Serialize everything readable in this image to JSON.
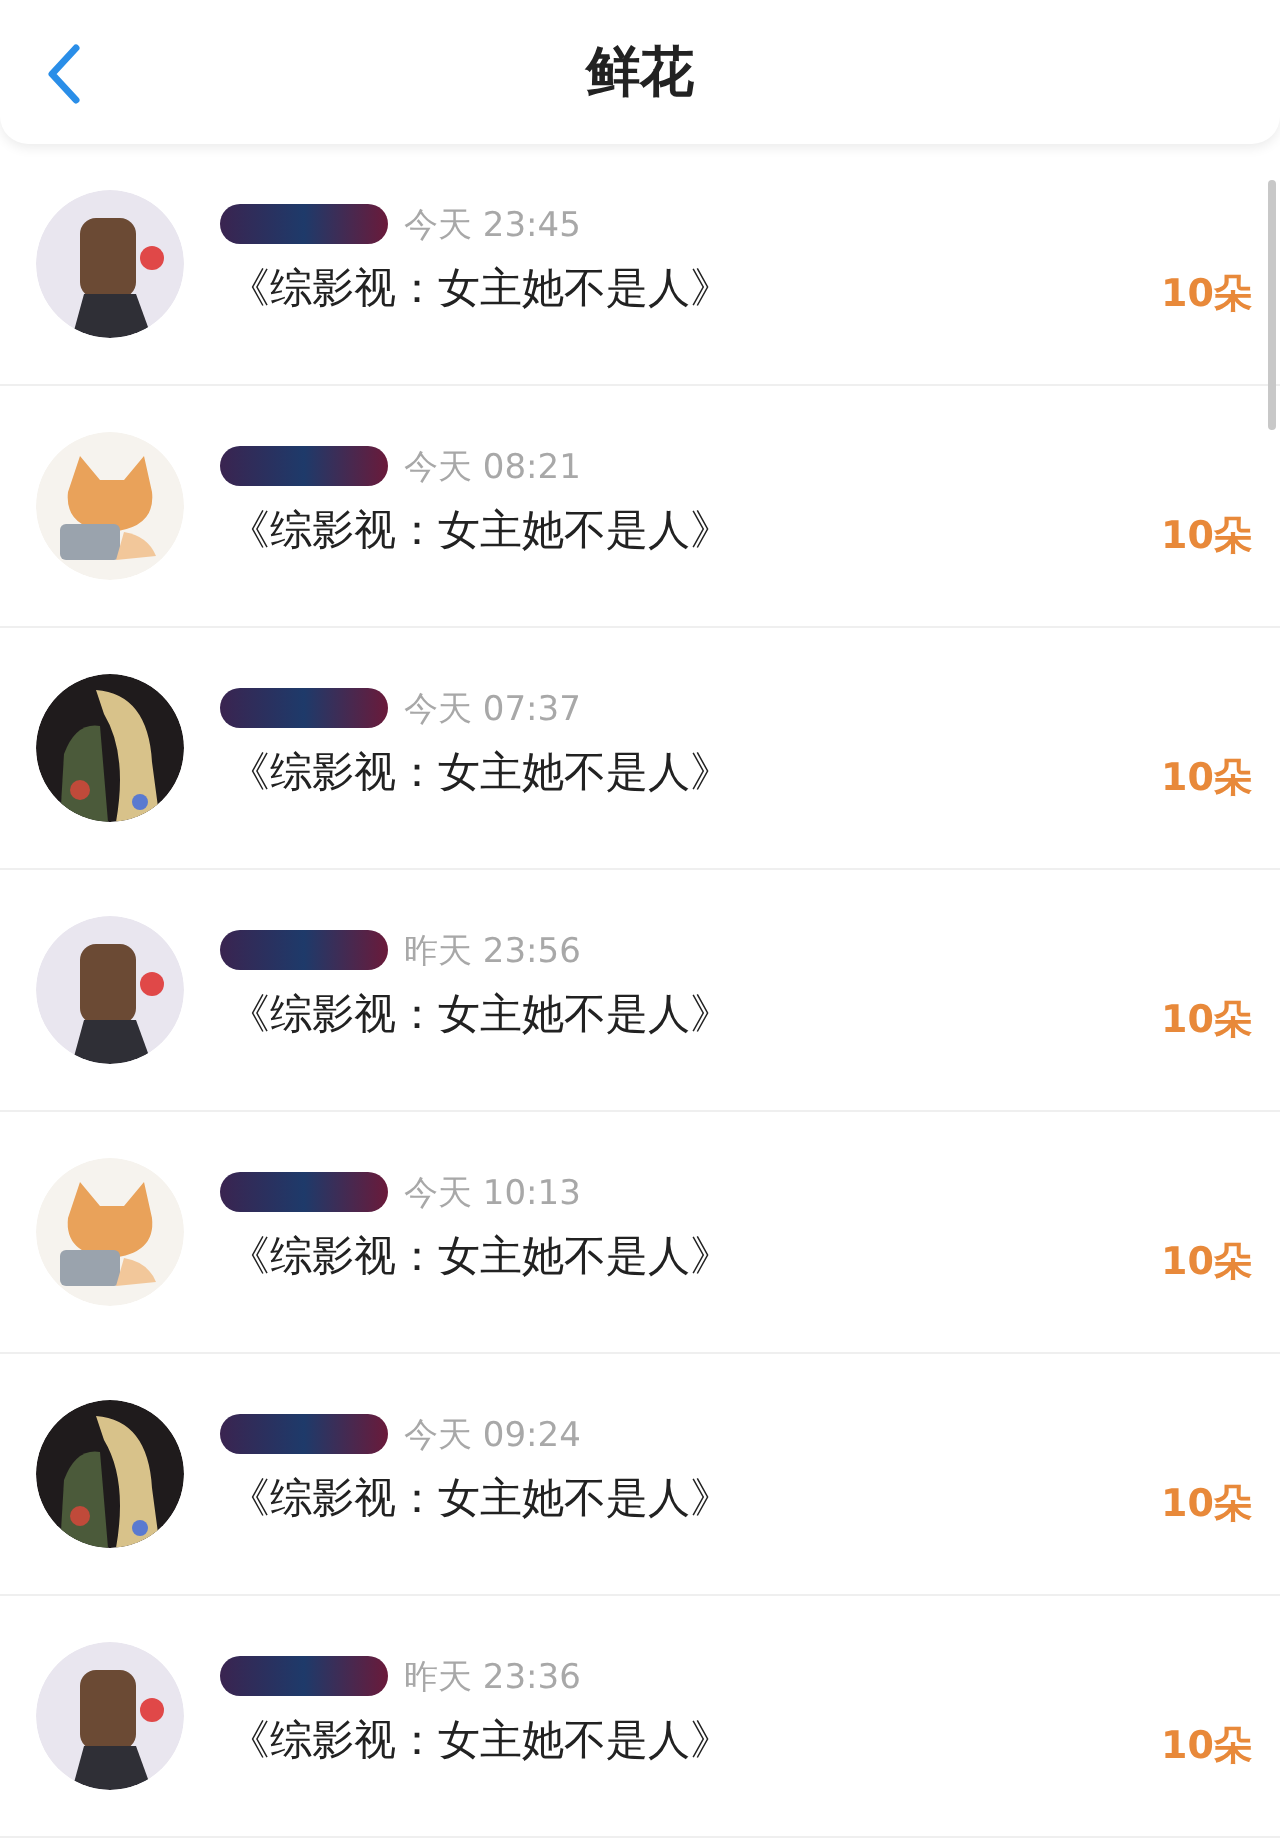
{
  "header": {
    "title": "鲜花"
  },
  "gifts": [
    {
      "kind": "figure",
      "time": "今天 23:45",
      "book": "《综影视：女主她不是人》",
      "count": "10朵"
    },
    {
      "kind": "cat",
      "time": "今天 08:21",
      "book": "《综影视：女主她不是人》",
      "count": "10朵"
    },
    {
      "kind": "portrait",
      "time": "今天 07:37",
      "book": "《综影视：女主她不是人》",
      "count": "10朵"
    },
    {
      "kind": "figure",
      "time": "昨天 23:56",
      "book": "《综影视：女主她不是人》",
      "count": "10朵"
    },
    {
      "kind": "cat",
      "time": "今天 10:13",
      "book": "《综影视：女主她不是人》",
      "count": "10朵"
    },
    {
      "kind": "portrait",
      "time": "今天 09:24",
      "book": "《综影视：女主她不是人》",
      "count": "10朵"
    },
    {
      "kind": "figure",
      "time": "昨天 23:36",
      "book": "《综影视：女主她不是人》",
      "count": "10朵"
    }
  ]
}
